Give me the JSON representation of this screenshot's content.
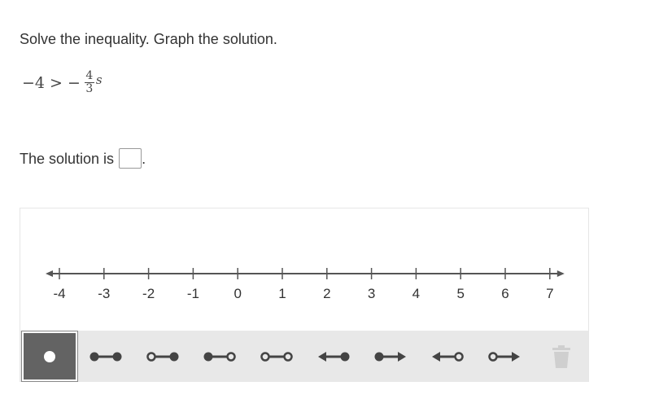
{
  "question": {
    "prompt": "Solve the inequality. Graph the solution.",
    "equation": {
      "lhs": "−4",
      "relation": ">",
      "sign": "−",
      "numerator": "4",
      "denominator": "3",
      "variable": "s"
    },
    "solution_prefix": "The solution is",
    "solution_suffix": ".",
    "solution_value": ""
  },
  "number_line": {
    "min": -4,
    "max": 7,
    "ticks": [
      "-4",
      "-3",
      "-2",
      "-1",
      "0",
      "1",
      "2",
      "3",
      "4",
      "5",
      "6",
      "7"
    ]
  },
  "toolbar": {
    "tools": [
      {
        "name": "point-tool",
        "icon": "point-icon",
        "selected": true
      },
      {
        "name": "closed-closed-segment-tool",
        "icon": "closed-closed-segment-icon",
        "selected": false
      },
      {
        "name": "open-closed-segment-tool",
        "icon": "open-closed-segment-icon",
        "selected": false
      },
      {
        "name": "closed-open-segment-tool",
        "icon": "closed-open-segment-icon",
        "selected": false
      },
      {
        "name": "open-open-segment-tool",
        "icon": "open-open-segment-icon",
        "selected": false
      },
      {
        "name": "left-ray-closed-tool",
        "icon": "left-ray-closed-icon",
        "selected": false
      },
      {
        "name": "right-ray-closed-tool",
        "icon": "right-ray-closed-icon",
        "selected": false
      },
      {
        "name": "left-ray-open-tool",
        "icon": "left-ray-open-icon",
        "selected": false
      },
      {
        "name": "right-ray-open-tool",
        "icon": "right-ray-open-icon",
        "selected": false
      },
      {
        "name": "delete-tool",
        "icon": "trash-icon",
        "selected": false,
        "disabled": true
      }
    ]
  },
  "colors": {
    "line": "#555555",
    "tool_icon": "#444444",
    "selected_bg": "#636363",
    "toolbar_bg": "#e8e8e8",
    "disabled_icon": "#cfcfcf"
  }
}
